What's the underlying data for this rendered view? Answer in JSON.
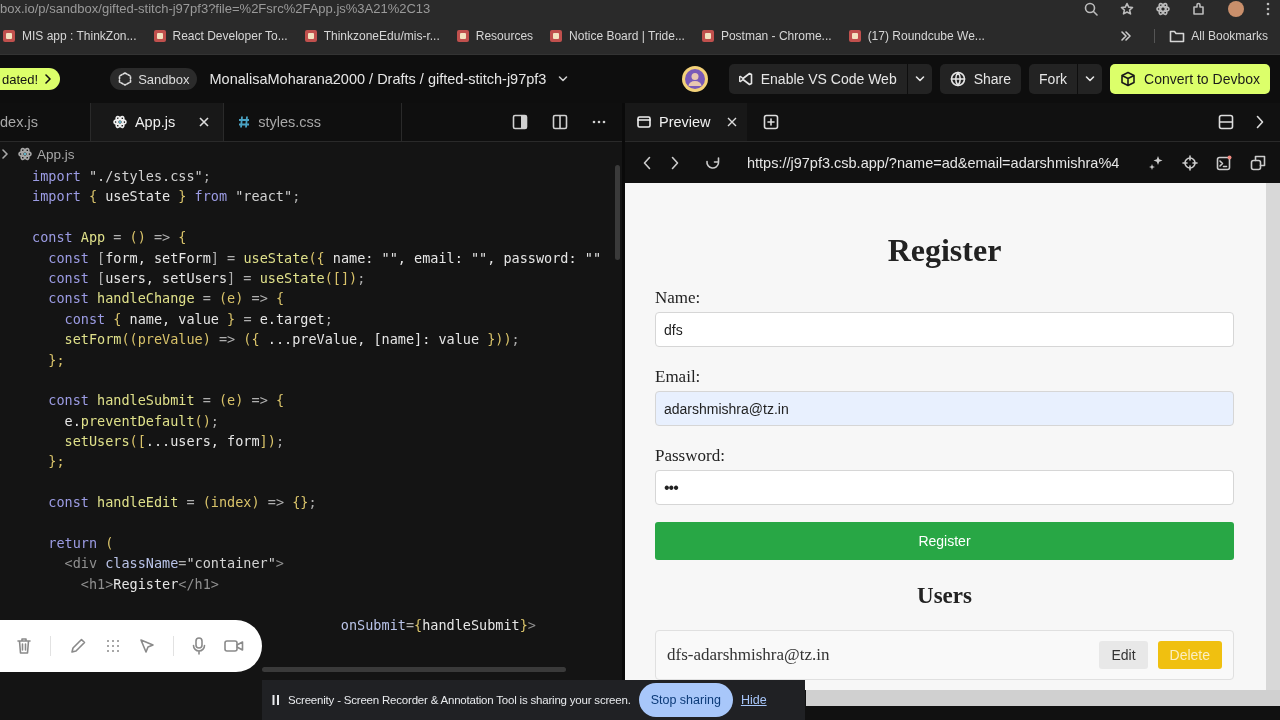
{
  "browser": {
    "url": "box.io/p/sandbox/gifted-stitch-j97pf3?file=%2Fsrc%2FApp.js%3A21%2C13",
    "bookmarks": [
      {
        "label": "MIS app : ThinkZon..."
      },
      {
        "label": "React Developer To..."
      },
      {
        "label": "ThinkzoneEdu/mis-r..."
      },
      {
        "label": "Resources"
      },
      {
        "label": "Notice Board | Tride..."
      },
      {
        "label": "Postman - Chrome..."
      },
      {
        "label": "(17) Roundcube We..."
      }
    ],
    "all_bookmarks": "All Bookmarks"
  },
  "header": {
    "update_pill": "dated!",
    "sandbox_chip": "Sandbox",
    "breadcrumb": "MonalisaMoharana2000 / Drafts / gifted-stitch-j97pf3",
    "vscode_button": "Enable VS Code Web",
    "share_button": "Share",
    "fork_button": "Fork",
    "devbox_button": "Convert to Devbox"
  },
  "editor": {
    "tabs": [
      {
        "label": "dex.js",
        "kind": "js",
        "selected": false
      },
      {
        "label": "App.js",
        "kind": "react",
        "selected": true
      },
      {
        "label": "styles.css",
        "kind": "css",
        "selected": false
      }
    ],
    "breadcrumb": "App.js",
    "lines": [
      {
        "kind": "code",
        "tokens": [
          {
            "kind": "kw",
            "text": "import "
          },
          {
            "kind": "str",
            "text": "\"./styles.css\""
          },
          {
            "kind": "p",
            "text": ";"
          }
        ]
      },
      {
        "kind": "code",
        "tokens": [
          {
            "kind": "kw",
            "text": "import "
          },
          {
            "kind": "br",
            "text": "{ "
          },
          {
            "kind": "var",
            "text": "useState "
          },
          {
            "kind": "br",
            "text": "} "
          },
          {
            "kind": "kw",
            "text": "from "
          },
          {
            "kind": "str",
            "text": "\"react\""
          },
          {
            "kind": "p",
            "text": ";"
          }
        ]
      },
      {
        "kind": "blank"
      },
      {
        "kind": "code",
        "tokens": [
          {
            "kind": "kw",
            "text": "const "
          },
          {
            "kind": "fn",
            "text": "App "
          },
          {
            "kind": "p",
            "text": "= "
          },
          {
            "kind": "br",
            "text": "() "
          },
          {
            "kind": "p",
            "text": "=> "
          },
          {
            "kind": "br",
            "text": "{"
          }
        ]
      },
      {
        "kind": "code",
        "tokens": [
          {
            "kind": "kw",
            "text": "  const "
          },
          {
            "kind": "p",
            "text": "["
          },
          {
            "kind": "var",
            "text": "form, setForm"
          },
          {
            "kind": "p",
            "text": "] = "
          },
          {
            "kind": "fn",
            "text": "useState"
          },
          {
            "kind": "br",
            "text": "({ "
          },
          {
            "kind": "var",
            "text": "name: \"\", email: \"\", password: \"\""
          }
        ]
      },
      {
        "kind": "code",
        "tokens": [
          {
            "kind": "kw",
            "text": "  const "
          },
          {
            "kind": "p",
            "text": "["
          },
          {
            "kind": "var",
            "text": "users, setUsers"
          },
          {
            "kind": "p",
            "text": "] = "
          },
          {
            "kind": "fn",
            "text": "useState"
          },
          {
            "kind": "br",
            "text": "([])"
          },
          {
            "kind": "p",
            "text": ";"
          }
        ]
      },
      {
        "kind": "code",
        "tokens": [
          {
            "kind": "kw",
            "text": "  const "
          },
          {
            "kind": "fn",
            "text": "handleChange "
          },
          {
            "kind": "p",
            "text": "= "
          },
          {
            "kind": "br",
            "text": "(e) "
          },
          {
            "kind": "p",
            "text": "=> "
          },
          {
            "kind": "br",
            "text": "{"
          }
        ]
      },
      {
        "kind": "code",
        "tokens": [
          {
            "kind": "kw",
            "text": "    const "
          },
          {
            "kind": "br",
            "text": "{ "
          },
          {
            "kind": "var",
            "text": "name, value "
          },
          {
            "kind": "br",
            "text": "} "
          },
          {
            "kind": "p",
            "text": "= "
          },
          {
            "kind": "var",
            "text": "e.target"
          },
          {
            "kind": "p",
            "text": ";"
          }
        ]
      },
      {
        "kind": "code",
        "tokens": [
          {
            "kind": "fn",
            "text": "    setForm"
          },
          {
            "kind": "br",
            "text": "((preValue) "
          },
          {
            "kind": "p",
            "text": "=> "
          },
          {
            "kind": "br",
            "text": "({ "
          },
          {
            "kind": "var",
            "text": "...preValue, [name]: value "
          },
          {
            "kind": "br",
            "text": "}))"
          },
          {
            "kind": "p",
            "text": ";"
          }
        ]
      },
      {
        "kind": "code",
        "tokens": [
          {
            "kind": "br",
            "text": "  };"
          }
        ]
      },
      {
        "kind": "blank"
      },
      {
        "kind": "code",
        "tokens": [
          {
            "kind": "kw",
            "text": "  const "
          },
          {
            "kind": "fn",
            "text": "handleSubmit "
          },
          {
            "kind": "p",
            "text": "= "
          },
          {
            "kind": "br",
            "text": "(e) "
          },
          {
            "kind": "p",
            "text": "=> "
          },
          {
            "kind": "br",
            "text": "{"
          }
        ]
      },
      {
        "kind": "code",
        "tokens": [
          {
            "kind": "var",
            "text": "    e."
          },
          {
            "kind": "fn",
            "text": "preventDefault"
          },
          {
            "kind": "br",
            "text": "()"
          },
          {
            "kind": "p",
            "text": ";"
          }
        ]
      },
      {
        "kind": "code",
        "tokens": [
          {
            "kind": "fn",
            "text": "    setUsers"
          },
          {
            "kind": "br",
            "text": "(["
          },
          {
            "kind": "var",
            "text": "...users, form"
          },
          {
            "kind": "br",
            "text": "])"
          },
          {
            "kind": "p",
            "text": ";"
          }
        ]
      },
      {
        "kind": "code",
        "tokens": [
          {
            "kind": "br",
            "text": "  };"
          }
        ]
      },
      {
        "kind": "blank"
      },
      {
        "kind": "code",
        "tokens": [
          {
            "kind": "kw",
            "text": "  const "
          },
          {
            "kind": "fn",
            "text": "handleEdit "
          },
          {
            "kind": "p",
            "text": "= "
          },
          {
            "kind": "br",
            "text": "(index) "
          },
          {
            "kind": "p",
            "text": "=> "
          },
          {
            "kind": "br",
            "text": "{}"
          },
          {
            "kind": "p",
            "text": ";"
          }
        ]
      },
      {
        "kind": "blank"
      },
      {
        "kind": "code",
        "tokens": [
          {
            "kind": "kw",
            "text": "  return "
          },
          {
            "kind": "br",
            "text": "("
          }
        ]
      },
      {
        "kind": "code",
        "tokens": [
          {
            "kind": "tag",
            "text": "    <div "
          },
          {
            "kind": "attr",
            "text": "className"
          },
          {
            "kind": "p",
            "text": "="
          },
          {
            "kind": "str",
            "text": "\"container\""
          },
          {
            "kind": "tag",
            "text": ">"
          }
        ]
      },
      {
        "kind": "code",
        "tokens": [
          {
            "kind": "tag",
            "text": "      <h1>"
          },
          {
            "kind": "var",
            "text": "Register"
          },
          {
            "kind": "tag",
            "text": "</h1>"
          }
        ]
      },
      {
        "kind": "blank"
      },
      {
        "kind": "code",
        "tokens": [
          {
            "kind": "attr",
            "text": "                                      onSubmit"
          },
          {
            "kind": "p",
            "text": "="
          },
          {
            "kind": "br",
            "text": "{"
          },
          {
            "kind": "var",
            "text": "handleSubmit"
          },
          {
            "kind": "br",
            "text": "}"
          },
          {
            "kind": "tag",
            "text": ">"
          }
        ]
      }
    ]
  },
  "preview": {
    "tab_label": "Preview",
    "url": "https://j97pf3.csb.app/?name=ad&email=adarshmishra%4",
    "page": {
      "title": "Register",
      "fields": [
        {
          "label": "Name:",
          "value": "dfs",
          "kind": "text",
          "autofilled": false
        },
        {
          "label": "Email:",
          "value": "adarshmishra@tz.in",
          "kind": "text",
          "autofilled": true
        },
        {
          "label": "Password:",
          "value": "•••",
          "kind": "password",
          "autofilled": false
        }
      ],
      "submit": "Register",
      "users_heading": "Users",
      "users": [
        {
          "text": "dfs-adarshmishra@tz.in",
          "edit": "Edit",
          "delete": "Delete"
        }
      ]
    }
  },
  "share_bar": {
    "message": "Screenity - Screen Recorder & Annotation Tool is sharing your screen.",
    "stop_button": "Stop sharing",
    "hide_link": "Hide"
  }
}
